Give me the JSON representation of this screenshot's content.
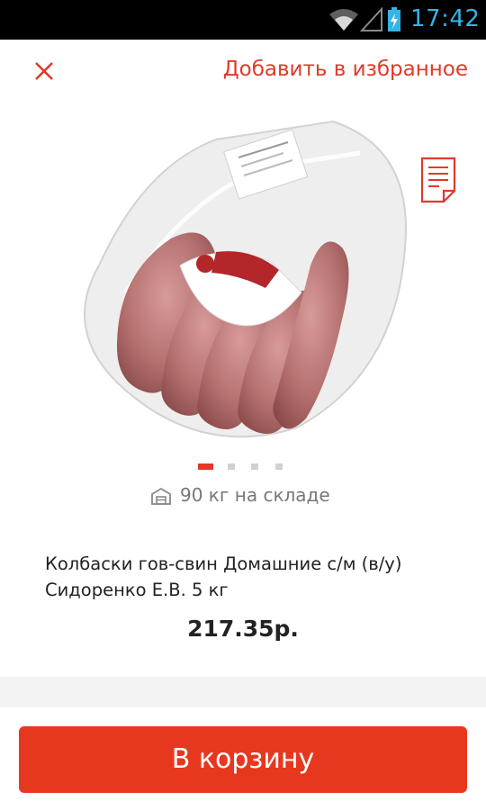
{
  "status_bar": {
    "time": "17:42",
    "icons": [
      "wifi-icon",
      "signal-icon",
      "battery-icon"
    ],
    "accent_color": "#33b5e5"
  },
  "header": {
    "close_icon": "close-icon",
    "favorite_label": "Добавить в избранное",
    "accent_color": "#e03a2a"
  },
  "gallery": {
    "image": "sausage-package-image",
    "doc_icon": "document-icon",
    "page_count": 4,
    "active_page": 1
  },
  "stock": {
    "icon": "warehouse-icon",
    "text": "90 кг на складе"
  },
  "product": {
    "title": "Колбаски гов-свин Домашние с/м (в/у) Сидоренко Е.В. 5 кг",
    "price": "217.35р."
  },
  "actions": {
    "cart_label": "В корзину",
    "button_color": "#e8371f"
  }
}
